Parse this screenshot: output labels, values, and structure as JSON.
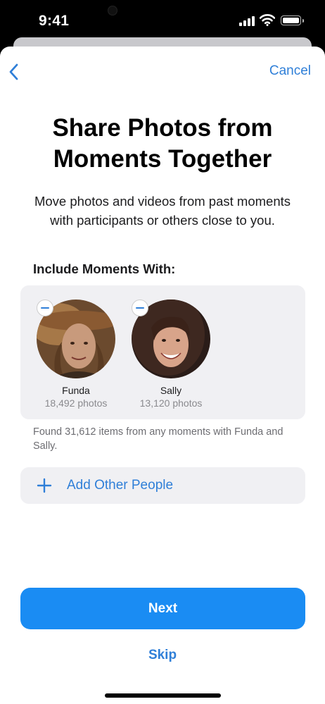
{
  "status_bar": {
    "time": "9:41"
  },
  "nav": {
    "back_icon": "chevron-left-icon",
    "cancel_label": "Cancel"
  },
  "title": "Share Photos from Moments Together",
  "subtitle": "Move photos and videos from past moments with participants or others close to you.",
  "section_heading": "Include Moments With:",
  "people": [
    {
      "name": "Funda",
      "count": "18,492 photos"
    },
    {
      "name": "Sally",
      "count": "13,120 photos"
    }
  ],
  "found_text": "Found 31,612 items from any moments with Funda and Sally.",
  "add_people_label": "Add Other People",
  "next_label": "Next",
  "skip_label": "Skip",
  "colors": {
    "accent": "#2f7fd8",
    "button": "#1a8cf3",
    "card": "#f0f0f3"
  }
}
